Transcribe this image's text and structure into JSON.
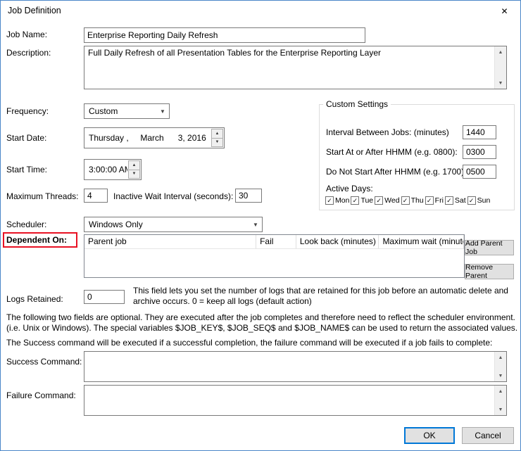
{
  "window": {
    "title": "Job Definition"
  },
  "icons": {
    "close": "✕",
    "dropdown": "▼",
    "up": "▲",
    "down": "▼",
    "check": "✓"
  },
  "form": {
    "job_name": {
      "label": "Job Name:",
      "value": "Enterprise Reporting Daily Refresh"
    },
    "description": {
      "label": "Description:",
      "value": "Full Daily Refresh of all Presentation Tables for the Enterprise Reporting Layer"
    },
    "frequency": {
      "label": "Frequency:",
      "value": "Custom"
    },
    "start_date": {
      "label": "Start Date:",
      "value": "Thursday ,     March      3, 2016"
    },
    "start_time": {
      "label": "Start Time:",
      "value": "3:00:00 AM"
    },
    "maximum_threads": {
      "label": "Maximum Threads:",
      "value": "4"
    },
    "inactive_wait": {
      "label": "Inactive Wait Interval (seconds):",
      "value": "30"
    },
    "scheduler": {
      "label": "Scheduler:",
      "value": "Windows Only"
    },
    "dependent_on": {
      "label": "Dependent On:"
    },
    "logs_retained": {
      "label": "Logs Retained:",
      "value": "0",
      "help": "This field lets you set the number of logs that are retained for this job before an automatic delete and archive occurs. 0 = keep all logs (default action)"
    },
    "success_command": {
      "label": "Success Command:",
      "value": ""
    },
    "failure_command": {
      "label": "Failure Command:",
      "value": ""
    }
  },
  "custom_settings": {
    "title": "Custom Settings",
    "interval": {
      "label": "Interval Between Jobs: (minutes)",
      "value": "1440"
    },
    "start_at": {
      "label": "Start At or After HHMM (e.g. 0800):",
      "value": "0300"
    },
    "not_after": {
      "label": "Do Not Start After HHMM (e.g. 1700):",
      "value": "0500"
    },
    "active_days_label": "Active Days:",
    "days": [
      {
        "label": "Mon",
        "checked": true
      },
      {
        "label": "Tue",
        "checked": true
      },
      {
        "label": "Wed",
        "checked": true
      },
      {
        "label": "Thu",
        "checked": true
      },
      {
        "label": "Fri",
        "checked": true
      },
      {
        "label": "Sat",
        "checked": true
      },
      {
        "label": "Sun",
        "checked": true
      }
    ]
  },
  "dependents_table": {
    "columns": [
      "Parent job",
      "Fail",
      "Look back (minutes)",
      "Maximum wait (minutes)"
    ],
    "rows": []
  },
  "buttons": {
    "add_parent": "Add Parent Job",
    "remove_parent": "Remove Parent",
    "ok": "OK",
    "cancel": "Cancel"
  },
  "notes": {
    "optional_info": "The following two fields are optional. They are executed after the job completes and therefore need to reflect the scheduler environment. (i.e. Unix or Windows). The special variables $JOB_KEY$, $JOB_SEQ$ and $JOB_NAME$ can be used to return the associated values.",
    "success_failure_info": "The Success command will be executed if a successful completion, the failure command will be executed if a job fails to complete:"
  },
  "colors": {
    "accent_blue": "#0078d7",
    "highlight_red": "#e81123"
  }
}
